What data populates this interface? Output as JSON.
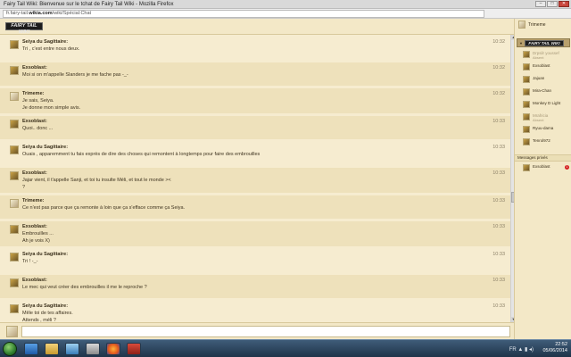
{
  "window": {
    "title": "Fairy Tail Wiki: Bienvenue sur le tchat de Fairy Tail Wiki - Mozilla Firefox"
  },
  "browser": {
    "url_prefix": "fr.fairy-tail.",
    "url_domain": "wikia.com",
    "url_path": "/wiki/Spécial:Chat"
  },
  "header": {
    "logo": "FAIRY TAIL WIKI"
  },
  "messages": [
    {
      "user": "Seiya du Sagittaire:",
      "lines": [
        "Tri , c'est entre nous deux."
      ],
      "time": "10:32",
      "avatar": "dark"
    },
    {
      "user": "Exsoblast:",
      "lines": [
        "Moi si on m'appelle Slanders je me fache pas -_-"
      ],
      "time": "10:32",
      "avatar": "dark"
    },
    {
      "user": "Trimeme:",
      "lines": [
        "Je sais, Seiya.",
        "Je donne mon simple avis."
      ],
      "time": "10:32",
      "avatar": "light"
    },
    {
      "user": "Exsoblast:",
      "lines": [
        "Quoi.. donc ..."
      ],
      "time": "10:33",
      "avatar": "dark"
    },
    {
      "user": "Seiya du Sagittaire:",
      "lines": [
        "Ouais , apparemment tu fais exprès de dire des choses qui remontent à longtemps pour faire des embrouilles"
      ],
      "time": "10:33",
      "avatar": "dark"
    },
    {
      "user": "Exsoblast:",
      "lines": [
        "Jajar vient, il t'appelle Sanji, et toi tu insulte Méli, et tout le monde ><",
        "?"
      ],
      "time": "10:33",
      "avatar": "dark"
    },
    {
      "user": "Trimeme:",
      "lines": [
        "Ce n'est pas parce que ça remonte à loin que ça s'efface comme ça Seiya."
      ],
      "time": "10:33",
      "avatar": "light"
    },
    {
      "user": "Exsoblast:",
      "lines": [
        "Embrouilles ...",
        "Ah je vois X)"
      ],
      "time": "10:33",
      "avatar": "dark"
    },
    {
      "user": "Seiya du Sagittaire:",
      "lines": [
        "Tri ! -_-"
      ],
      "time": "10:33",
      "avatar": "dark"
    },
    {
      "user": "Exsoblast:",
      "lines": [
        "Le mec qui veut créer des embrouilles il me le reproche ?"
      ],
      "time": "10:33",
      "avatar": "dark"
    },
    {
      "user": "Seiya du Sagittaire:",
      "lines": [
        "Mêle toi de tes affaires.",
        "Attends , méli ?"
      ],
      "time": "10:33",
      "avatar": "dark"
    }
  ],
  "input": {
    "placeholder": ""
  },
  "sidebar": {
    "me": "Trimeme",
    "room_logo": "FAIRY TAIL WIKI",
    "users": [
      {
        "name": "Drpsilr youssef",
        "status": "Absent",
        "away": true
      },
      {
        "name": "Exsoblast",
        "status": "",
        "away": false
      },
      {
        "name": "Jajuan",
        "status": "",
        "away": false
      },
      {
        "name": "Mira-Chan",
        "status": "",
        "away": false
      },
      {
        "name": "Monkey D Light",
        "status": "",
        "away": false
      },
      {
        "name": "Mrafricia",
        "status": "Absent",
        "away": true
      },
      {
        "name": "Ryuu-dama",
        "status": "",
        "away": false
      },
      {
        "name": "Tenrol972",
        "status": "",
        "away": false
      }
    ],
    "pm_header": "Messages privés",
    "pm_user": "Exsoblast",
    "pm_badge": "1"
  },
  "taskbar": {
    "time": "22:52",
    "date": "05/06/2014",
    "lang": "FR"
  },
  "colors": {
    "chat_bg": "#f6ecd0",
    "alt_row": "#eee1bb",
    "accent": "#b8a06d"
  }
}
